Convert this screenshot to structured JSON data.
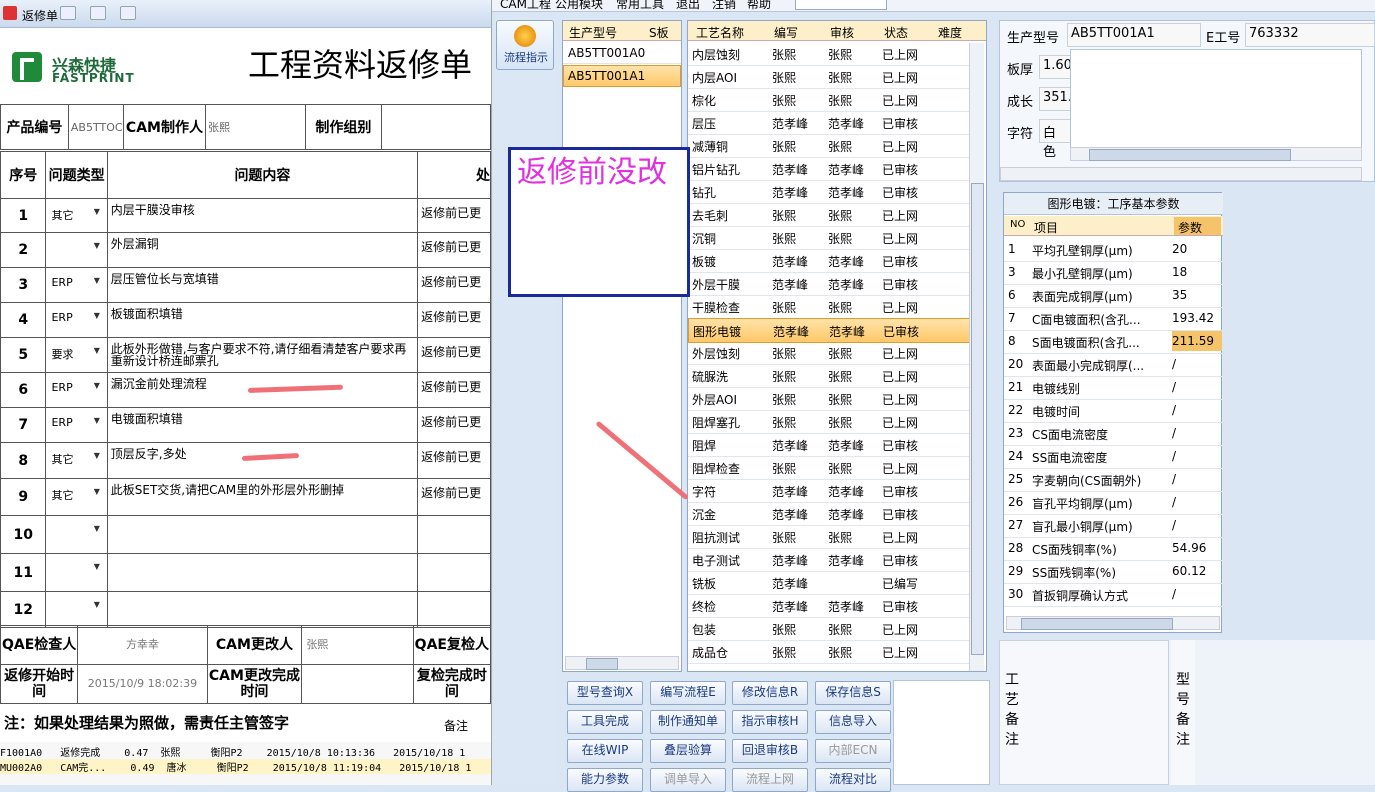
{
  "left_window": {
    "title": "返修单",
    "logo_cn": "兴森快捷",
    "logo_en": "FASTPRINT",
    "doc_title": "工程资料返修单",
    "header": {
      "product_label": "产品编号",
      "product_value": "AB5TTOC",
      "cam_maker_label": "CAM制作人",
      "cam_maker_value": "张熙",
      "group_label": "制作组别"
    },
    "columns": [
      "序号",
      "问题类型",
      "问题内容",
      "处"
    ],
    "rows": [
      {
        "no": "1",
        "type": "其它",
        "content": "内层干膜没审核",
        "result": "返修前已更"
      },
      {
        "no": "2",
        "type": "",
        "content": "外层漏铜",
        "result": "返修前已更"
      },
      {
        "no": "3",
        "type": "ERP",
        "content": "层压管位长与宽填错",
        "result": "返修前已更"
      },
      {
        "no": "4",
        "type": "ERP",
        "content": "板镀面积填错",
        "result": "返修前已更"
      },
      {
        "no": "5",
        "type": "要求",
        "content": "此板外形做错,与客户要求不符,请仔细看清楚客户要求再重新设计桥连邮票孔",
        "result": "返修前已更"
      },
      {
        "no": "6",
        "type": "ERP",
        "content": "漏沉金前处理流程",
        "result": "返修前已更"
      },
      {
        "no": "7",
        "type": "ERP",
        "content": "电镀面积填错",
        "result": "返修前已更"
      },
      {
        "no": "8",
        "type": "其它",
        "content": "顶层反字,多处",
        "result": "返修前已更"
      },
      {
        "no": "9",
        "type": "其它",
        "content": "此板SET交货,请把CAM里的外形层外形删掉",
        "result": "返修前已更"
      },
      {
        "no": "10",
        "type": "",
        "content": "",
        "result": ""
      },
      {
        "no": "11",
        "type": "",
        "content": "",
        "result": ""
      },
      {
        "no": "12",
        "type": "",
        "content": "",
        "result": ""
      }
    ],
    "footer": {
      "qae_check_label": "QAE检查人",
      "qae_check_value": "方幸幸",
      "cam_change_label": "CAM更改人",
      "cam_change_value": "张熙",
      "qae_recheck_label": "QAE复检人",
      "rework_start_label": "返修开始时间",
      "rework_start_value": "2015/10/9 18:02:39",
      "cam_done_label": "CAM更改完成时间",
      "recheck_done_label": "复检完成时间"
    },
    "note": "注：如果处理结果为照做，需责任主管签字",
    "note_remark": "备注",
    "under_rows": [
      "F1001A0   返修完成    0.47  张熙     衡阳P2    2015/10/8 10:13:36   2015/10/18 1",
      "MU002A0   CAM完...    0.49  唐冰     衡阳P2    2015/10/8 11:19:04   2015/10/18 1"
    ]
  },
  "right_window": {
    "menu": [
      "CAM工程",
      "公用模块",
      "常用工具",
      "退出",
      "注销",
      "帮助"
    ],
    "flow_button": "流程指示",
    "model_panel": {
      "col1": "生产型号",
      "col2": "S板",
      "items": [
        {
          "model": "AB5TT001A0",
          "selected": false
        },
        {
          "model": "AB5TT001A1",
          "selected": true
        }
      ]
    },
    "process_panel": {
      "columns": [
        "工艺名称",
        "编写",
        "审核",
        "状态",
        "难度"
      ],
      "rows": [
        [
          "内层蚀刻",
          "张熙",
          "张熙",
          "已上网"
        ],
        [
          "内层AOI",
          "张熙",
          "张熙",
          "已上网"
        ],
        [
          "棕化",
          "张熙",
          "张熙",
          "已上网"
        ],
        [
          "层压",
          "范孝峰",
          "范孝峰",
          "已审核"
        ],
        [
          "减薄铜",
          "张熙",
          "张熙",
          "已上网"
        ],
        [
          "铝片钻孔",
          "范孝峰",
          "范孝峰",
          "已审核"
        ],
        [
          "钻孔",
          "范孝峰",
          "范孝峰",
          "已审核"
        ],
        [
          "去毛刺",
          "张熙",
          "张熙",
          "已上网"
        ],
        [
          "沉铜",
          "张熙",
          "张熙",
          "已上网"
        ],
        [
          "板镀",
          "范孝峰",
          "范孝峰",
          "已审核"
        ],
        [
          "外层干膜",
          "范孝峰",
          "范孝峰",
          "已审核"
        ],
        [
          "干膜检查",
          "张熙",
          "张熙",
          "已上网"
        ],
        [
          "图形电镀",
          "范孝峰",
          "范孝峰",
          "已审核"
        ],
        [
          "外层蚀刻",
          "张熙",
          "张熙",
          "已上网"
        ],
        [
          "硫脲洗",
          "张熙",
          "张熙",
          "已上网"
        ],
        [
          "外层AOI",
          "张熙",
          "张熙",
          "已上网"
        ],
        [
          "阻焊塞孔",
          "张熙",
          "张熙",
          "已上网"
        ],
        [
          "阻焊",
          "范孝峰",
          "范孝峰",
          "已审核"
        ],
        [
          "阻焊检查",
          "张熙",
          "张熙",
          "已上网"
        ],
        [
          "字符",
          "范孝峰",
          "范孝峰",
          "已审核"
        ],
        [
          "沉金",
          "范孝峰",
          "范孝峰",
          "已审核"
        ],
        [
          "阻抗测试",
          "张熙",
          "张熙",
          "已上网"
        ],
        [
          "电子测试",
          "范孝峰",
          "范孝峰",
          "已审核"
        ],
        [
          "铣板",
          "范孝峰",
          "",
          "已编写"
        ],
        [
          "终检",
          "范孝峰",
          "范孝峰",
          "已审核"
        ],
        [
          "包装",
          "张熙",
          "张熙",
          "已上网"
        ],
        [
          "成品仓",
          "张熙",
          "张熙",
          "已上网"
        ]
      ],
      "selected_index": 12
    },
    "annotation": "返修前没改",
    "info": {
      "model_label": "生产型号",
      "model_value": "AB5TT001A1",
      "e_label": "E工号",
      "e_value": "763332",
      "thick_label": "板厚",
      "thick_value": "1.60",
      "growth_label": "成长",
      "growth_value": "351.",
      "char_label": "字符",
      "char_value": "白色"
    },
    "param_grid": {
      "title": "图形电镀：工序基本参数",
      "columns": [
        "NO",
        "项目",
        "参数"
      ],
      "rows": [
        [
          "1",
          "平均孔壁铜厚(μm)",
          "20"
        ],
        [
          "3",
          "最小孔壁铜厚(μm)",
          "18"
        ],
        [
          "6",
          "表面完成铜厚(μm)",
          "35"
        ],
        [
          "7",
          "C面电镀面积(含孔...",
          "193.42"
        ],
        [
          "8",
          "S面电镀面积(含孔...",
          "211.59"
        ],
        [
          "20",
          "表面最小完成铜厚(...",
          "/"
        ],
        [
          "21",
          "电镀线别",
          "/"
        ],
        [
          "22",
          "电镀时间",
          "/"
        ],
        [
          "23",
          "CS面电流密度",
          "/"
        ],
        [
          "24",
          "SS面电流密度",
          "/"
        ],
        [
          "25",
          "字麦朝向(CS面朝外)",
          "/"
        ],
        [
          "26",
          "盲孔平均铜厚(μm)",
          "/"
        ],
        [
          "27",
          "盲孔最小铜厚(μm)",
          "/"
        ],
        [
          "28",
          "CS面残铜率(%)",
          "54.96"
        ],
        [
          "29",
          "SS面残铜率(%)",
          "60.12"
        ],
        [
          "30",
          "首扳铜厚确认方式",
          "/"
        ]
      ]
    },
    "remarks": {
      "process_note": "工艺备注",
      "model_note": "型号备注"
    },
    "buttons": [
      {
        "label": "型号查询X",
        "enabled": true
      },
      {
        "label": "编写流程E",
        "enabled": true
      },
      {
        "label": "修改信息R",
        "enabled": true
      },
      {
        "label": "保存信息S",
        "enabled": true
      },
      {
        "label": "工具完成",
        "enabled": true
      },
      {
        "label": "制作通知单",
        "enabled": true
      },
      {
        "label": "指示审核H",
        "enabled": true
      },
      {
        "label": "信息导入",
        "enabled": true
      },
      {
        "label": "在线WIP",
        "enabled": true
      },
      {
        "label": "叠层验算",
        "enabled": true
      },
      {
        "label": "回退审核B",
        "enabled": true
      },
      {
        "label": "内部ECN",
        "enabled": false
      },
      {
        "label": "能力参数",
        "enabled": true
      },
      {
        "label": "调单导入",
        "enabled": false
      },
      {
        "label": "流程上网",
        "enabled": false
      },
      {
        "label": "流程对比",
        "enabled": true
      }
    ]
  },
  "colors": {
    "annotation_text": "#e030e0",
    "annotation_border": "#1a2a9a",
    "arrow": "#f07078",
    "selected_row": "#ffc86a",
    "brand_green": "#1f8a3a"
  }
}
